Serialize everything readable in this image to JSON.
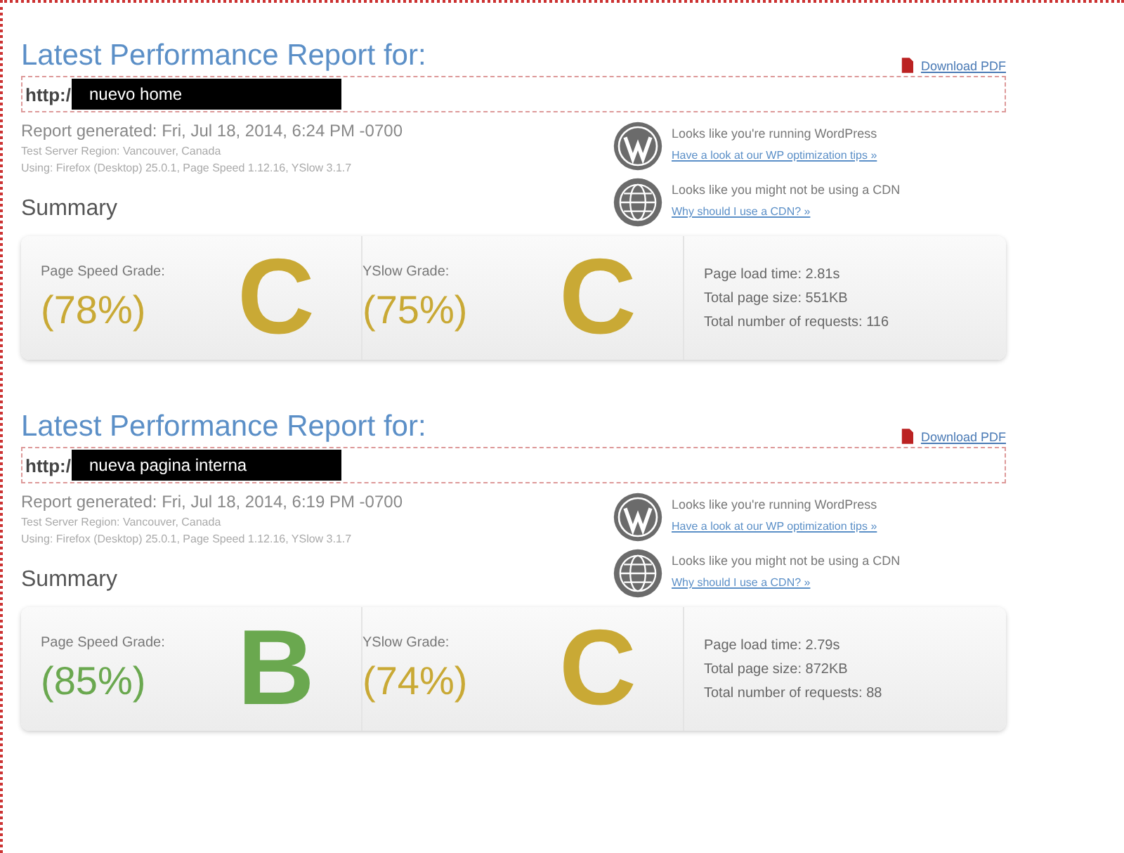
{
  "reports": [
    {
      "title": "Latest Performance Report for:",
      "download": "Download PDF",
      "url_prefix": "http:/",
      "url_label": "nuevo home",
      "generated": "Report generated: Fri, Jul 18, 2014, 6:24 PM -0700",
      "server": "Test Server Region: Vancouver, Canada",
      "using": "Using: Firefox (Desktop) 25.0.1, Page Speed 1.12.16, YSlow 3.1.7",
      "notices": [
        {
          "kind": "wordpress",
          "text": "Looks like you're running WordPress",
          "link": "Have a look at our WP optimization tips »"
        },
        {
          "kind": "cdn",
          "text": "Looks like you might not be using a CDN",
          "link": "Why should I use a CDN? »"
        }
      ],
      "summary_title": "Summary",
      "grades": [
        {
          "label": "Page Speed Grade:",
          "score": "(78%)",
          "letter": "C",
          "color": "#c9a935"
        },
        {
          "label": "YSlow Grade:",
          "score": "(75%)",
          "letter": "C",
          "color": "#c9a935"
        }
      ],
      "stats": [
        {
          "label": "Page load time:",
          "value": "2.81s"
        },
        {
          "label": "Total page size:",
          "value": "551KB"
        },
        {
          "label": "Total number of requests:",
          "value": "116"
        }
      ]
    },
    {
      "title": "Latest Performance Report for:",
      "download": "Download PDF",
      "url_prefix": "http:/",
      "url_label": "nueva pagina interna",
      "generated": "Report generated: Fri, Jul 18, 2014, 6:19 PM -0700",
      "server": "Test Server Region: Vancouver, Canada",
      "using": "Using: Firefox (Desktop) 25.0.1, Page Speed 1.12.16, YSlow 3.1.7",
      "notices": [
        {
          "kind": "wordpress",
          "text": "Looks like you're running WordPress",
          "link": "Have a look at our WP optimization tips »"
        },
        {
          "kind": "cdn",
          "text": "Looks like you might not be using a CDN",
          "link": "Why should I use a CDN? »"
        }
      ],
      "summary_title": "Summary",
      "grades": [
        {
          "label": "Page Speed Grade:",
          "score": "(85%)",
          "letter": "B",
          "color": "#6aa84f"
        },
        {
          "label": "YSlow Grade:",
          "score": "(74%)",
          "letter": "C",
          "color": "#c9a935"
        }
      ],
      "stats": [
        {
          "label": "Page load time:",
          "value": "2.79s"
        },
        {
          "label": "Total page size:",
          "value": "872KB"
        },
        {
          "label": "Total number of requests:",
          "value": "88"
        }
      ]
    }
  ]
}
